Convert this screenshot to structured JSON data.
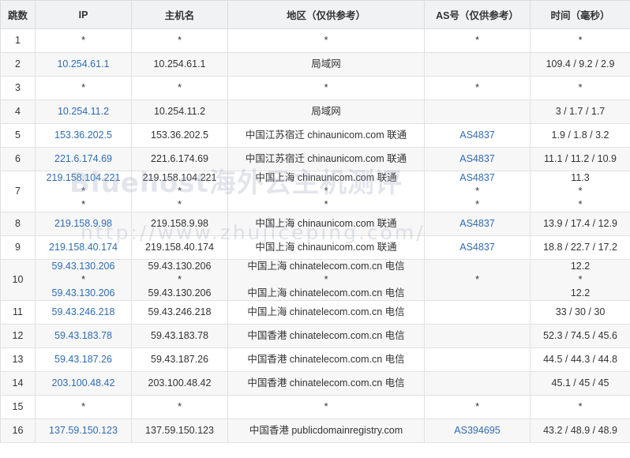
{
  "headers": [
    "跳数",
    "IP",
    "主机名",
    "地区（仅供参考）",
    "AS号（仅供参考）",
    "时间（毫秒）"
  ],
  "rows": [
    {
      "hop": "1",
      "ip": [
        "*"
      ],
      "host": [
        "*"
      ],
      "region": [
        "*"
      ],
      "as": [
        "*"
      ],
      "time": [
        "*"
      ]
    },
    {
      "hop": "2",
      "ip": [
        "10.254.61.1"
      ],
      "host": [
        "10.254.61.1"
      ],
      "region": [
        "局域网"
      ],
      "as": [
        ""
      ],
      "time": [
        "109.4 / 9.2 / 2.9"
      ]
    },
    {
      "hop": "3",
      "ip": [
        "*"
      ],
      "host": [
        "*"
      ],
      "region": [
        "*"
      ],
      "as": [
        "*"
      ],
      "time": [
        "*"
      ]
    },
    {
      "hop": "4",
      "ip": [
        "10.254.11.2"
      ],
      "host": [
        "10.254.11.2"
      ],
      "region": [
        "局域网"
      ],
      "as": [
        ""
      ],
      "time": [
        "3 / 1.7 / 1.7"
      ]
    },
    {
      "hop": "5",
      "ip": [
        "153.36.202.5"
      ],
      "host": [
        "153.36.202.5"
      ],
      "region": [
        "中国江苏宿迁 chinaunicom.com 联通"
      ],
      "as": [
        "AS4837"
      ],
      "time": [
        "1.9 / 1.8 / 3.2"
      ]
    },
    {
      "hop": "6",
      "ip": [
        "221.6.174.69"
      ],
      "host": [
        "221.6.174.69"
      ],
      "region": [
        "中国江苏宿迁 chinaunicom.com 联通"
      ],
      "as": [
        "AS4837"
      ],
      "time": [
        "11.1 / 11.2 / 10.9"
      ]
    },
    {
      "hop": "7",
      "ip": [
        "219.158.104.221",
        "*",
        "*"
      ],
      "host": [
        "219.158.104.221",
        "*",
        "*"
      ],
      "region": [
        "中国上海 chinaunicom.com 联通",
        "*",
        "*"
      ],
      "as": [
        "AS4837",
        "*",
        "*"
      ],
      "time": [
        "11.3",
        "*",
        "*"
      ]
    },
    {
      "hop": "8",
      "ip": [
        "219.158.9.98"
      ],
      "host": [
        "219.158.9.98"
      ],
      "region": [
        "中国上海 chinaunicom.com 联通"
      ],
      "as": [
        "AS4837"
      ],
      "time": [
        "13.9 / 17.4 / 12.9"
      ]
    },
    {
      "hop": "9",
      "ip": [
        "219.158.40.174"
      ],
      "host": [
        "219.158.40.174"
      ],
      "region": [
        "中国上海 chinaunicom.com 联通"
      ],
      "as": [
        "AS4837"
      ],
      "time": [
        "18.8 / 22.7 / 17.2"
      ]
    },
    {
      "hop": "10",
      "ip": [
        "59.43.130.206",
        "*",
        "59.43.130.206"
      ],
      "host": [
        "59.43.130.206",
        "*",
        "59.43.130.206"
      ],
      "region": [
        "中国上海 chinatelecom.com.cn 电信",
        "*",
        "中国上海 chinatelecom.com.cn 电信"
      ],
      "as": [
        "*"
      ],
      "time": [
        "12.2",
        "*",
        "12.2"
      ]
    },
    {
      "hop": "11",
      "ip": [
        "59.43.246.218"
      ],
      "host": [
        "59.43.246.218"
      ],
      "region": [
        "中国上海 chinatelecom.com.cn 电信"
      ],
      "as": [
        ""
      ],
      "time": [
        "33 / 30 / 30"
      ]
    },
    {
      "hop": "12",
      "ip": [
        "59.43.183.78"
      ],
      "host": [
        "59.43.183.78"
      ],
      "region": [
        "中国香港 chinatelecom.com.cn 电信"
      ],
      "as": [
        ""
      ],
      "time": [
        "52.3 / 74.5 / 45.6"
      ]
    },
    {
      "hop": "13",
      "ip": [
        "59.43.187.26"
      ],
      "host": [
        "59.43.187.26"
      ],
      "region": [
        "中国香港 chinatelecom.com.cn 电信"
      ],
      "as": [
        ""
      ],
      "time": [
        "44.5 / 44.3 / 44.8"
      ]
    },
    {
      "hop": "14",
      "ip": [
        "203.100.48.42"
      ],
      "host": [
        "203.100.48.42"
      ],
      "region": [
        "中国香港 chinatelecom.com.cn 电信"
      ],
      "as": [
        ""
      ],
      "time": [
        "45.1 / 45 / 45"
      ]
    },
    {
      "hop": "15",
      "ip": [
        "*"
      ],
      "host": [
        "*"
      ],
      "region": [
        "*"
      ],
      "as": [
        "*"
      ],
      "time": [
        "*"
      ]
    },
    {
      "hop": "16",
      "ip": [
        "137.59.150.123"
      ],
      "host": [
        "137.59.150.123"
      ],
      "region": [
        "中国香港 publicdomainregistry.com"
      ],
      "as": [
        "AS394695"
      ],
      "time": [
        "43.2 / 48.9 / 48.9"
      ]
    }
  ],
  "watermarks": {
    "main": "Bluehost海外云主机测评",
    "url": "http://www.zhujiceping.com/"
  },
  "colors": {
    "link": "#2f6cb0",
    "header_bg": "#f1f2f4",
    "odd_row_bg": "#f7f7f7",
    "border": "#e1e1e1"
  }
}
